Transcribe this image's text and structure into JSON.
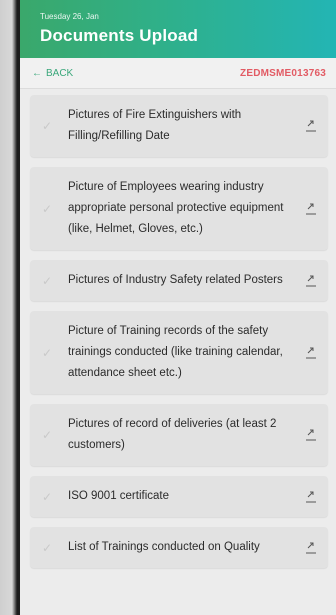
{
  "header": {
    "date": "Tuesday 26, Jan",
    "title": "Documents Upload"
  },
  "subbar": {
    "back_label": "BACK",
    "doc_id": "ZEDMSME013763"
  },
  "documents": [
    {
      "label": "Pictures of Fire Extinguishers with Filling/Refilling Date"
    },
    {
      "label": "Picture of Employees wearing industry appropriate personal protective equipment (like, Helmet, Gloves, etc.)"
    },
    {
      "label": "Pictures of Industry Safety related Posters"
    },
    {
      "label": "Picture of Training records of the safety trainings conducted (like training calendar, attendance sheet etc.)"
    },
    {
      "label": "Pictures of record of deliveries (at least 2 customers)"
    },
    {
      "label": "ISO 9001 certificate"
    },
    {
      "label": "List of Trainings conducted on Quality"
    }
  ],
  "icons": {
    "back": "arrow-left-icon",
    "check": "check-icon",
    "upload": "upload-icon"
  },
  "colors": {
    "header_start": "#3aa86b",
    "header_end": "#23b5b4",
    "back_text": "#39a77a",
    "doc_id": "#e25b64"
  }
}
